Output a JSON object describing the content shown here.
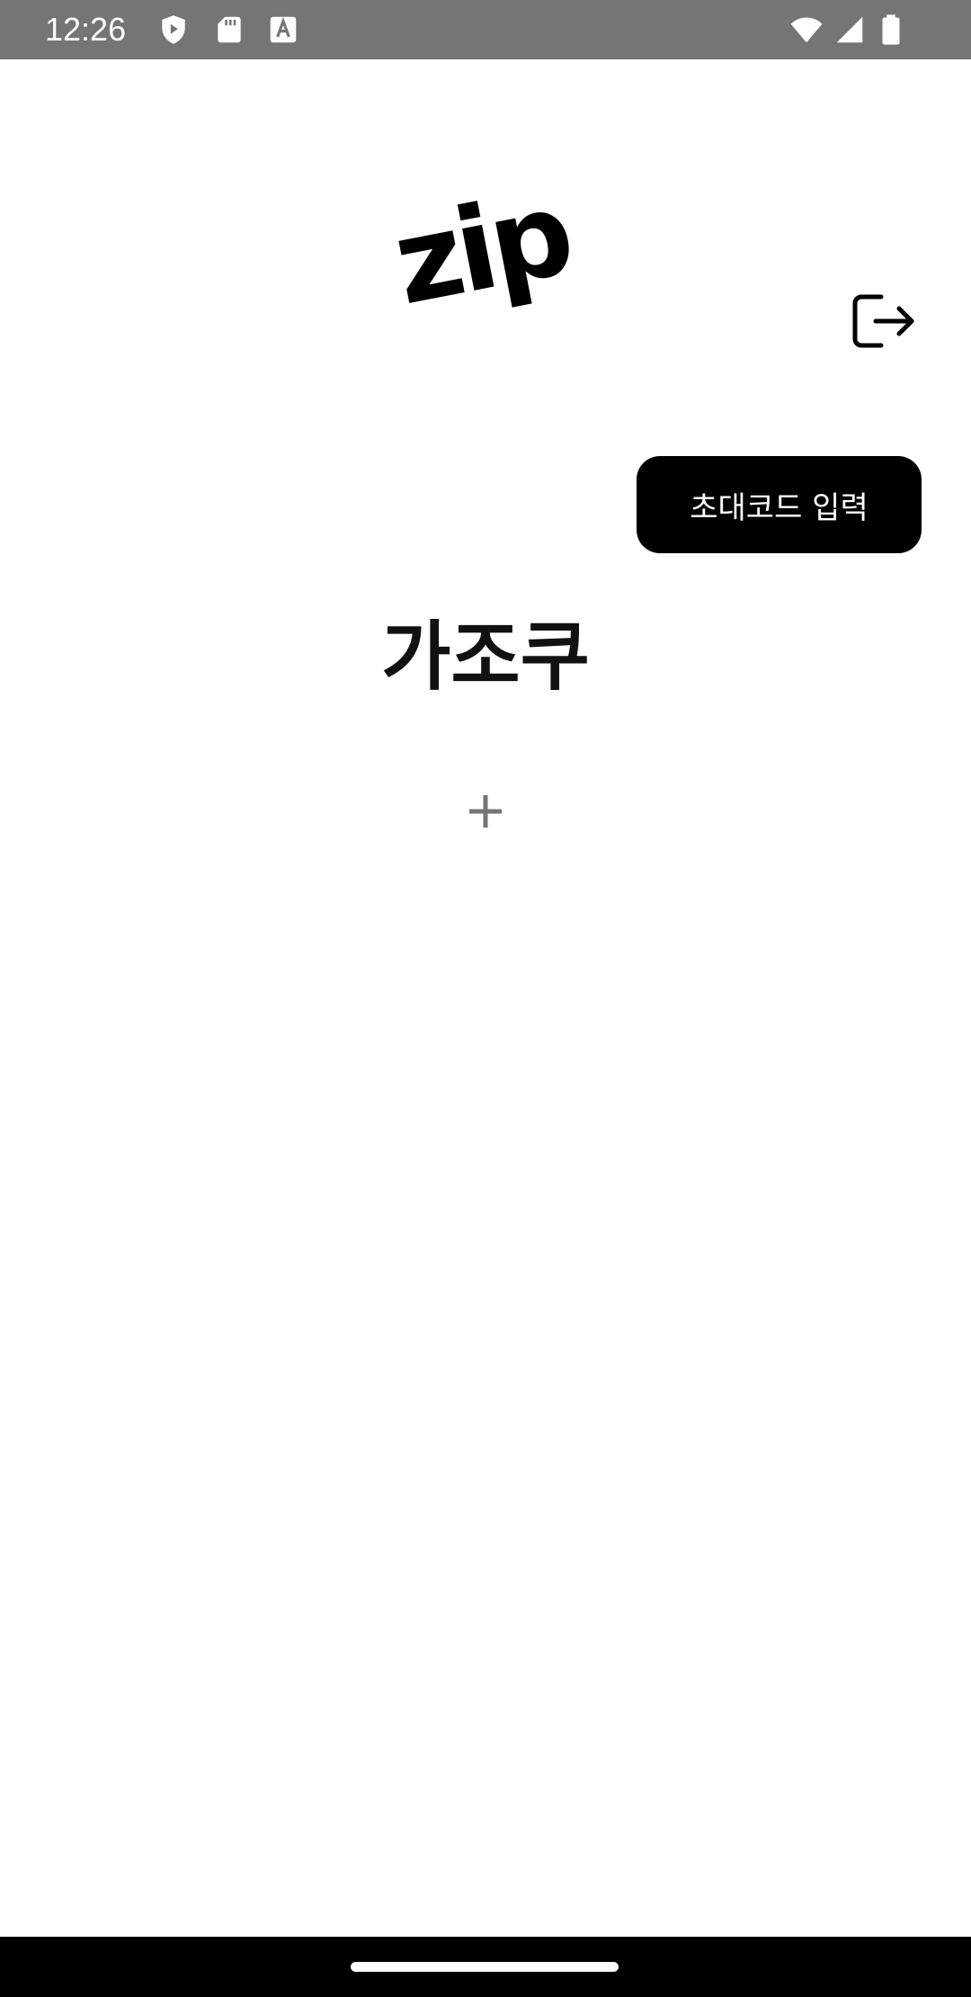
{
  "status_bar": {
    "time": "12:26",
    "icons": [
      "shield-icon",
      "sd-card-icon",
      "font-a-icon",
      "wifi-icon",
      "signal-icon",
      "battery-icon"
    ]
  },
  "header": {
    "logo_text": "zip",
    "logout_icon": "logout-icon"
  },
  "actions": {
    "invite_label": "초대코드 입력",
    "add_icon": "plus-icon"
  },
  "group": {
    "title": "가조쿠"
  },
  "colors": {
    "status_bar_bg": "#757575",
    "button_bg": "#000000",
    "button_text": "#ffffff",
    "plus_icon": "#757575",
    "nav_bar_bg": "#000000"
  }
}
